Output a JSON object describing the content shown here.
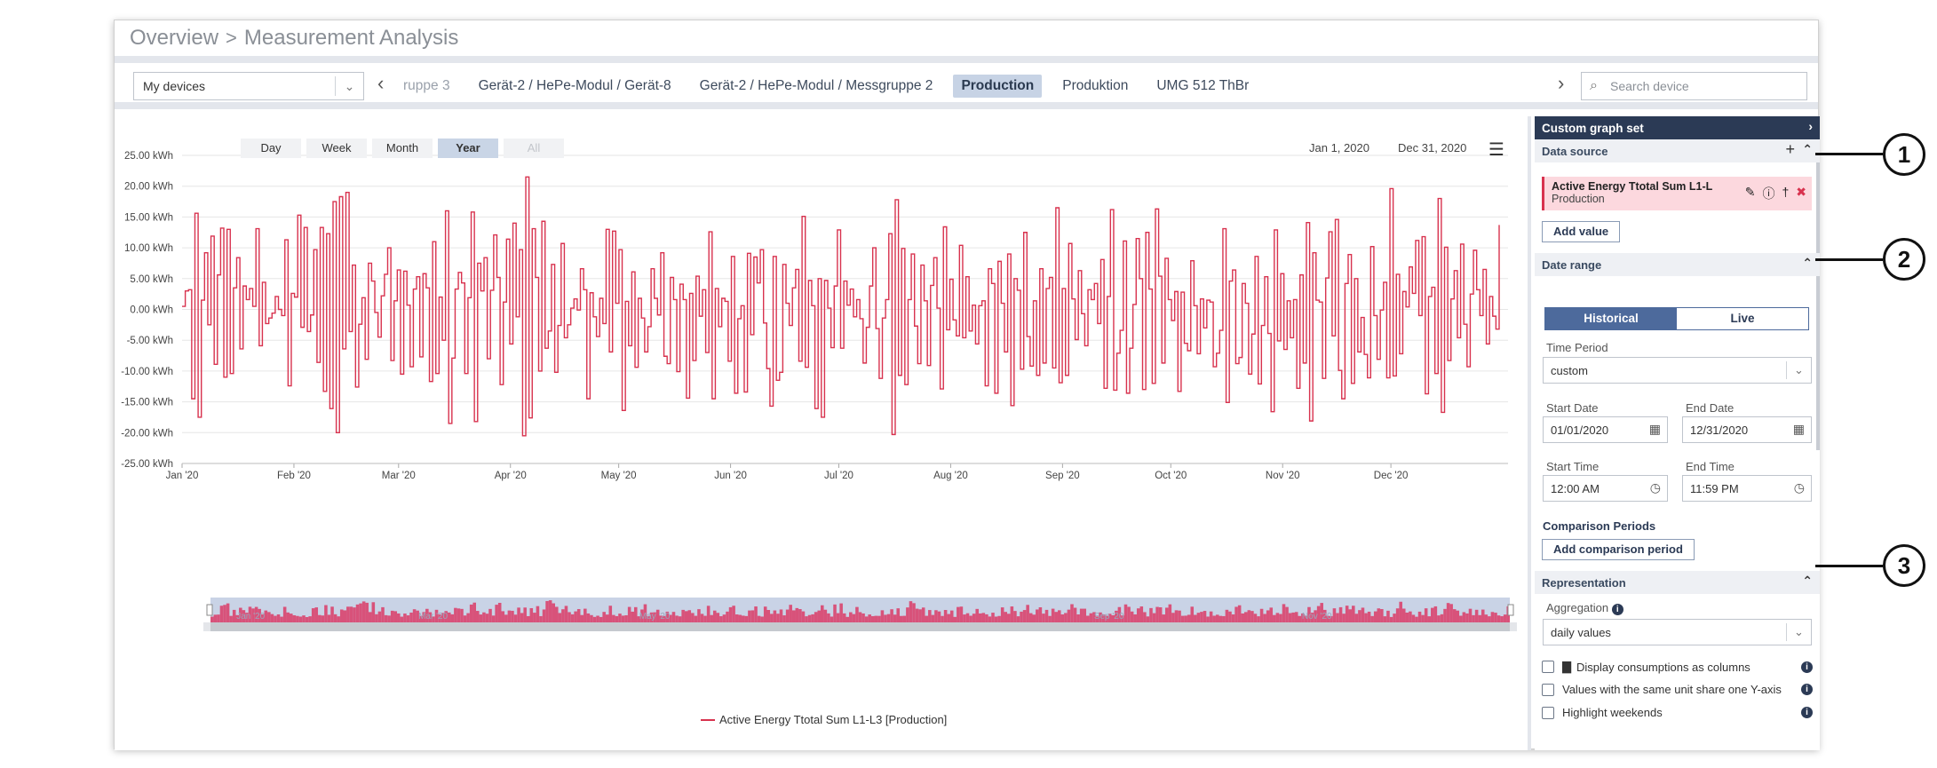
{
  "breadcrumb": {
    "root": "Overview",
    "sep": ">",
    "current": "Measurement Analysis"
  },
  "devices": {
    "selector_value": "My devices",
    "tabs": [
      {
        "label": "ruppe 3",
        "state": "faded"
      },
      {
        "label": "Gerät-2 / HePe-Modul / Gerät-8",
        "state": ""
      },
      {
        "label": "Gerät-2 / HePe-Modul / Messgruppe 2",
        "state": ""
      },
      {
        "label": "Production",
        "state": "active"
      },
      {
        "label": "Produktion",
        "state": ""
      },
      {
        "label": "UMG 512 ThBr",
        "state": ""
      }
    ],
    "search_placeholder": "Search device"
  },
  "toolbar": {
    "ranges": [
      "Day",
      "Week",
      "Month",
      "Year",
      "All"
    ],
    "active_range": "Year",
    "date_from": "Jan 1, 2020",
    "date_to": "Dec 31, 2020"
  },
  "legend": {
    "label": "Active Energy Ttotal Sum L1-L3 [Production]",
    "color": "#d8324e"
  },
  "navigator_labels": [
    "Jan '20",
    "Mar '20",
    "May '20",
    "Sep '20",
    "Nov '20"
  ],
  "chart_data": {
    "type": "line",
    "step": true,
    "series": [
      {
        "name": "Active Energy Ttotal Sum L1-L3 [Production]",
        "color": "#d8324e",
        "values": [
          0.5,
          3,
          3.2,
          -14.5,
          15.6,
          -17.5,
          1.5,
          9.2,
          -2.5,
          11.9,
          -8.9,
          5.6,
          13.2,
          -11,
          13,
          -10.4,
          3.5,
          8.4,
          -6.4,
          3.8,
          1.6,
          3.4,
          0.5,
          13.1,
          -5.9,
          4.4,
          -2.3,
          -1.4,
          -0.6,
          2.1,
          0,
          -1,
          11.3,
          -12.4,
          2.6,
          2,
          15.3,
          -2.9,
          13.3,
          -3.6,
          -0.9,
          9.7,
          -8.6,
          13.3,
          -13.3,
          12.3,
          -16.1,
          17.5,
          -20,
          18.3,
          -6.4,
          19,
          -3.6,
          7.2,
          -12.6,
          -2.4,
          1.9,
          -8.1,
          7.5,
          4.6,
          -0.5,
          -4.5,
          2.2,
          5.7,
          10,
          -8.3,
          1.4,
          6.4,
          -10.5,
          6.2,
          0.7,
          -9.3,
          3.3,
          5.3,
          -7.7,
          5.8,
          3.5,
          -11.7,
          11,
          -10.4,
          2,
          -5,
          16,
          -18.5,
          -7.9,
          3.3,
          6,
          4.3,
          -10.4,
          1.9,
          15.8,
          -18.2,
          7.5,
          3,
          8.4,
          -8,
          3.1,
          12.1,
          5.2,
          -12.2,
          1.2,
          11.4,
          -5.6,
          14,
          -1.2,
          9.7,
          -20.5,
          21.5,
          -17.6,
          13.1,
          5.2,
          -10,
          14.3,
          -6.3,
          -3.5,
          7.3,
          -10.2,
          -2.6,
          10.7,
          -4.6,
          -2.5,
          0.2,
          1.7,
          -0.1,
          6.6,
          3.2,
          -14.5,
          2.7,
          -1.2,
          -4.4,
          1.8,
          -2.3,
          13,
          -6.9,
          12.7,
          1,
          9.7,
          -16.4,
          1.3,
          -5.9,
          6.1,
          -9.4,
          1.8,
          -1.4,
          -6.9,
          -2.8,
          6.6,
          1.8,
          -0.9,
          9.2,
          -7.6,
          -8.8,
          5.2,
          1.6,
          -10.1,
          4.1,
          1.6,
          -14.4,
          2.6,
          -8.3,
          5.4,
          -1.1,
          3.2,
          -7,
          12.6,
          -14.5,
          3.4,
          -2.8,
          1.8,
          1.3,
          -8.4,
          8.6,
          -13.6,
          -1.5,
          0.6,
          -13.4,
          9.1,
          -4.1,
          8.5,
          4.3,
          9.7,
          -2.2,
          -9.6,
          -15.7,
          8.6,
          -11.5,
          -10.2,
          7.3,
          1,
          -2.6,
          3.5,
          6.5,
          -8.4,
          15.1,
          -9.4,
          4.7,
          0.6,
          -16.1,
          5,
          -17.5,
          4.7,
          0.2,
          -6.2,
          3.8,
          12.9,
          -6.3,
          4.6,
          0.7,
          3.3,
          -1.2,
          1.6,
          -1.5,
          -8.7,
          -2.9,
          3.8,
          10,
          -3.1,
          -11.2,
          -1.4,
          1.6,
          12.3,
          -20.3,
          17.8,
          -10.7,
          9.9,
          -12.2,
          1.6,
          9,
          -2.7,
          -8.8,
          7.2,
          1.4,
          -9.1,
          3.9,
          8.4,
          0.2,
          -12.9,
          13.4,
          -3.3,
          4.9,
          -1.7,
          -4.3,
          10.4,
          -4.6,
          5.3,
          -3.5,
          0.7,
          -5.6,
          0.6,
          1.4,
          -12.4,
          6.6,
          4.2,
          -13.6,
          7.8,
          1,
          -6.9,
          9,
          -15.6,
          5,
          3.1,
          -9.7,
          12.5,
          -4.4,
          -9.2,
          1.4,
          -10.7,
          6.6,
          -8.7,
          3.4,
          5.2,
          -9.5,
          16.5,
          -11.9,
          3.4,
          -10.7,
          10.7,
          1.7,
          -4.9,
          6.3,
          -0.7,
          -5.9,
          3.2,
          1.6,
          4.2,
          -2.3,
          8.1,
          -12.8,
          2.1,
          16.2,
          -13.1,
          -7.1,
          -3.4,
          11.1,
          -13.6,
          -6.3,
          0.8,
          11.5,
          5,
          -13,
          12.5,
          3.3,
          -12,
          16.3,
          5.4,
          -8.7,
          8.3,
          1.6,
          -1.8,
          2.9,
          -13.3,
          2.8,
          -5.5,
          -6.7,
          7.9,
          0.6,
          -7.2,
          1.7,
          -3,
          1.5,
          1.2,
          -9.3,
          -7.1,
          -3.4,
          13.1,
          -15.1,
          4.6,
          6.4,
          -8.8,
          -7.8,
          4.2,
          1,
          -10.5,
          -4,
          8.6,
          -12.1,
          -2.6,
          5.3,
          -3.9,
          -16.6,
          12.9,
          -5.1,
          5.8,
          -6.5,
          1.4,
          -4.6,
          1.6,
          -12.8,
          5.6,
          -8.7,
          14.1,
          -18.1,
          9.2,
          1.5,
          1.2,
          -11.2,
          5.1,
          12.6,
          -4.3,
          14.6,
          -9.9,
          -14.5,
          4.2,
          8.9,
          -12,
          5,
          -6.9,
          -1.3,
          -7.3,
          -11.1,
          10.2,
          -1,
          -8.1,
          -0.1,
          4.4,
          -11.1,
          19.6,
          -10.8,
          5.7,
          -7.2,
          2.9,
          0.4,
          6.9,
          2.6,
          11.2,
          -1,
          11.8,
          -13.7,
          2.1,
          3.6,
          -10.4,
          18,
          -16.7,
          10.1,
          -8.3,
          1.7,
          6.3,
          -4.6,
          10.6,
          -2.4,
          -9.3,
          2.5,
          9.6,
          3.2,
          -1,
          6.5,
          -5.6,
          2.1,
          -1.1,
          -3.2,
          13.7
        ]
      }
    ],
    "xlabel": "",
    "ylabel": "",
    "x_range": [
      "2020-01-01",
      "2020-12-31"
    ],
    "ylim": [
      -25,
      25
    ],
    "y_ticks": [
      25,
      20,
      15,
      10,
      5,
      0,
      -5,
      -10,
      -15,
      -20,
      -25
    ],
    "y_tick_labels": [
      "25.00 kWh",
      "20.00 kWh",
      "15.00 kWh",
      "10.00 kWh",
      "5.00 kWh",
      "0.00 kWh",
      "-5.00 kWh",
      "-10.00 kWh",
      "-15.00 kWh",
      "-20.00 kWh",
      "-25.00 kWh"
    ],
    "x_tick_labels": [
      "Jan '20",
      "Feb '20",
      "Mar '20",
      "Apr '20",
      "May '20",
      "Jun '20",
      "Jul '20",
      "Aug '20",
      "Sep '20",
      "Oct '20",
      "Nov '20",
      "Dec '20"
    ],
    "grid": true,
    "legend_position": "bottom-center"
  },
  "panel": {
    "title": "Custom graph set",
    "data_source": {
      "heading": "Data source",
      "item_name": "Active Energy Ttotal Sum L1-L",
      "item_sub": "Production",
      "add_value": "Add value"
    },
    "date_range": {
      "heading": "Date range",
      "mode_historical": "Historical",
      "mode_live": "Live",
      "time_period_label": "Time Period",
      "time_period_value": "custom",
      "start_date_label": "Start Date",
      "start_date": "01/01/2020",
      "end_date_label": "End Date",
      "end_date": "12/31/2020",
      "start_time_label": "Start Time",
      "start_time": "12:00 AM",
      "end_time_label": "End Time",
      "end_time": "11:59 PM",
      "comparison_heading": "Comparison Periods",
      "add_comparison": "Add comparison period"
    },
    "representation": {
      "heading": "Representation",
      "aggregation_label": "Aggregation",
      "aggregation_value": "daily values",
      "options": [
        "Display consumptions as columns",
        "Values with the same unit share one Y-axis",
        "Highlight weekends"
      ]
    }
  },
  "callouts": [
    "1",
    "2",
    "3"
  ]
}
